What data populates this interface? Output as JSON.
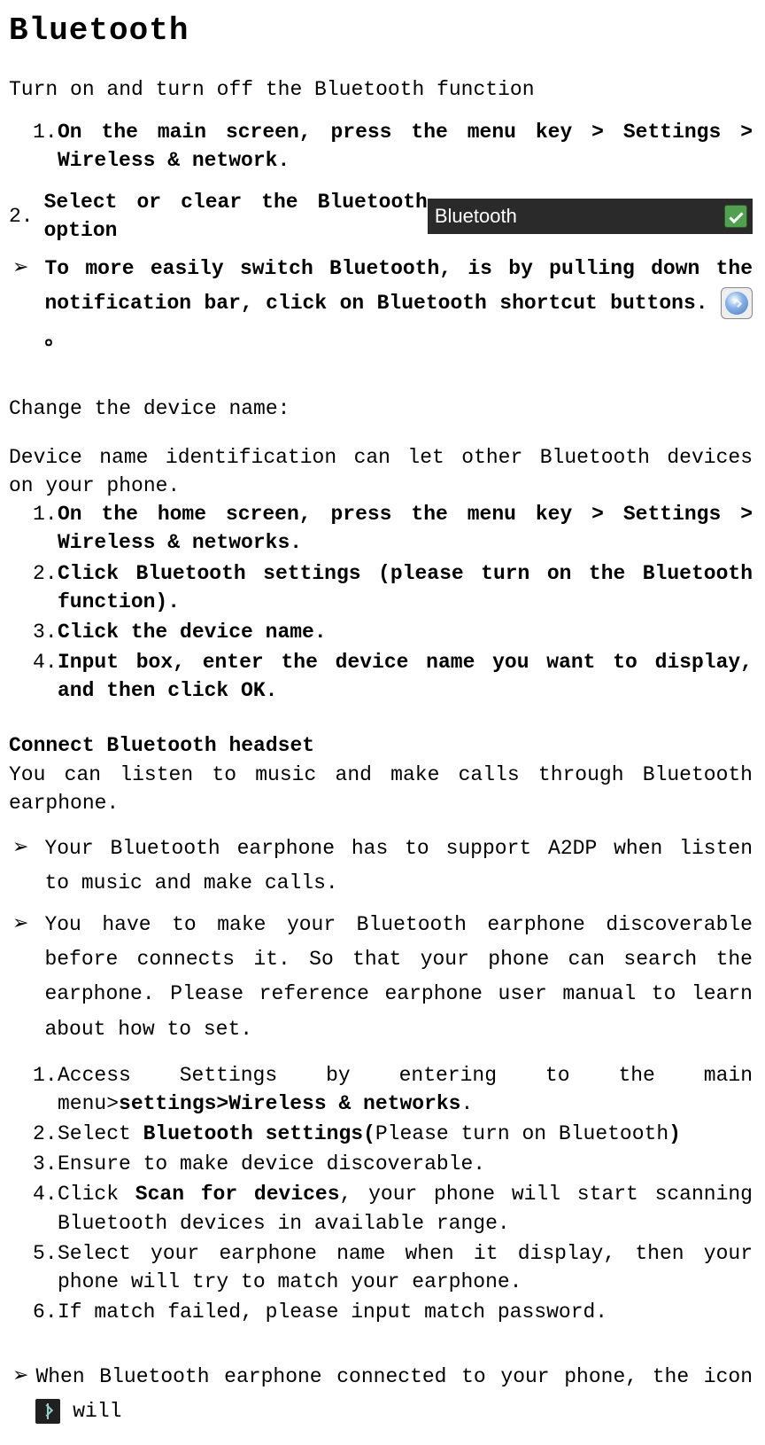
{
  "page_title": "Bluetooth",
  "section1": {
    "heading": "Turn on and turn off the Bluetooth function",
    "step1": "On the main screen, press the menu key > Settings > Wireless & network.",
    "step2_num": "2.",
    "step2_text": "Select or clear the Bluetooth option",
    "bt_label": "Bluetooth",
    "arrow1": "To more easily switch Bluetooth, is by pulling down the notification bar, click on Bluetooth shortcut buttons. ",
    "arrow1_suffix": "。"
  },
  "section2": {
    "heading": "Change the device name:",
    "intro": "Device name identification can let other Bluetooth devices on your phone.",
    "step1": "On the home screen, press the menu key > Settings > Wireless & networks.",
    "step2": "Click Bluetooth settings (please turn on the Bluetooth function).",
    "step3": "Click the device name.",
    "step4": "Input box, enter the device name you want to display, and then click OK."
  },
  "section3": {
    "heading": "Connect Bluetooth headset",
    "intro": "You can listen to music and make calls through Bluetooth earphone.",
    "tip1": "Your Bluetooth earphone has to support A2DP when listen to music and make calls.",
    "tip2": "You have to make your Bluetooth earphone discoverable before connects it. So that your phone can search the earphone. Please reference earphone user manual to learn about how to set.",
    "step1_a": "Access Settings by entering to the main menu>",
    "step1_b": "settings>Wireless & networks",
    "step1_c": ".",
    "step2_a": "Select ",
    "step2_b": "Bluetooth settings(",
    "step2_c": "Please turn on Bluetooth",
    "step2_d": ")",
    "step3": "Ensure to make device discoverable.",
    "step4_a": "Click ",
    "step4_b": "Scan for devices",
    "step4_c": ", your phone will start scanning Bluetooth devices in available range.",
    "step5": "Select your earphone name when it display, then your phone will try to match your earphone.",
    "step6": "If match failed, please input match password.",
    "bottom_a": "When Bluetooth earphone connected to your phone, the icon ",
    "bottom_b": " will"
  }
}
